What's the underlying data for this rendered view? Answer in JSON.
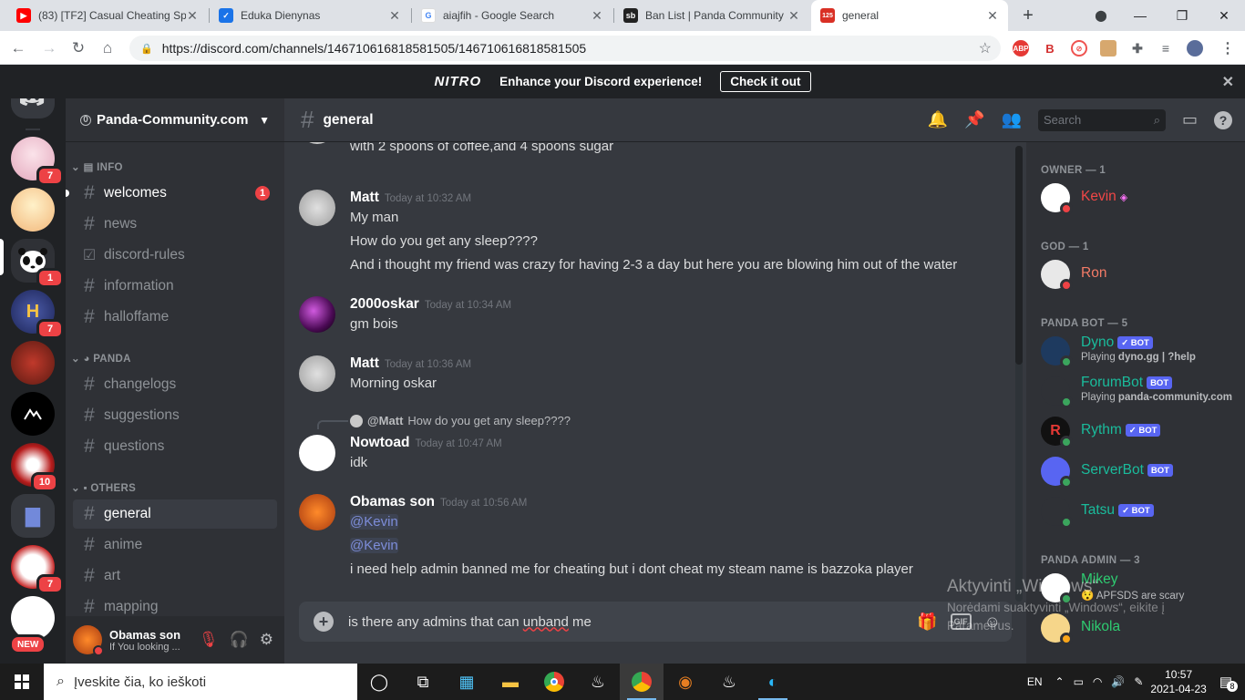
{
  "browser": {
    "tabs": [
      {
        "label": "(83) [TF2] Casual Cheating Sp",
        "icon": "youtube-icon",
        "color": "#ff0000"
      },
      {
        "label": "Eduka Dienynas",
        "icon": "eduka-icon",
        "color": "#1a73e8"
      },
      {
        "label": "aiajfih - Google Search",
        "icon": "google-icon",
        "color": "#4285f4"
      },
      {
        "label": "Ban List | Panda Community S",
        "icon": "sourcebans-icon",
        "color": "#222222"
      },
      {
        "label": "general",
        "icon": "calendar-icon",
        "color": "#d93025",
        "fav_text": "125"
      }
    ],
    "new_tab": "+",
    "url": "https://discord.com/channels/146710616818581505/146710616818581505"
  },
  "nitro": {
    "logo": "NITRO",
    "text": "Enhance your Discord experience!",
    "cta": "Check it out",
    "close": "✕"
  },
  "servers": [
    {
      "name": "anime-girl-server",
      "badge": "7",
      "color": "#e8b4c8"
    },
    {
      "name": "blonde-anime-server",
      "badge": "",
      "color": "#f6c98a"
    },
    {
      "name": "panda-community",
      "badge": "1",
      "color": "#2f3136"
    },
    {
      "name": "hypixel-server",
      "badge": "7",
      "color": "#3b4a8a"
    },
    {
      "name": "tf2-server",
      "badge": "",
      "color": "#8a3a2a"
    },
    {
      "name": "mountain-logo-server",
      "badge": "",
      "color": "#000000"
    },
    {
      "name": "red-character-server",
      "badge": "10",
      "color": "#8a1010"
    },
    {
      "name": "folder",
      "badge": "",
      "color": "#2f3136"
    },
    {
      "name": "cfab-server",
      "badge": "7",
      "color": "#dddddd"
    },
    {
      "name": "sketch-server",
      "badge": "",
      "color": "#ffffff"
    }
  ],
  "new_label": "NEW",
  "guild": {
    "name": "Panda-Community.com",
    "icon_text": "0"
  },
  "categories": [
    {
      "name": "INFO",
      "channels": [
        {
          "name": "welcomes",
          "badge": "1",
          "unread": true
        },
        {
          "name": "news"
        },
        {
          "name": "discord-rules",
          "rules": true
        },
        {
          "name": "information"
        },
        {
          "name": "halloffame"
        }
      ]
    },
    {
      "name": "PANDA",
      "channels": [
        {
          "name": "changelogs"
        },
        {
          "name": "suggestions"
        },
        {
          "name": "questions"
        }
      ]
    },
    {
      "name": "OTHERS",
      "channels": [
        {
          "name": "general",
          "selected": true
        },
        {
          "name": "anime"
        },
        {
          "name": "art"
        },
        {
          "name": "mapping"
        }
      ]
    }
  ],
  "user": {
    "name": "Obamas son",
    "status": "If You looking ..."
  },
  "channel": {
    "name": "general",
    "search_placeholder": "Search"
  },
  "messages": [
    {
      "author": "",
      "time": "",
      "lines": [
        "with 2 spoons of coffee,and 4 spoons sugar"
      ]
    },
    {
      "author": "Matt",
      "time": "Today at 10:32 AM",
      "lines": [
        "My man",
        "How do you get any sleep????",
        "And i thought my friend was crazy for having 2-3 a day but here you are blowing him out of the water"
      ]
    },
    {
      "author": "2000oskar",
      "time": "Today at 10:34 AM",
      "lines": [
        "gm bois"
      ]
    },
    {
      "author": "Matt",
      "time": "Today at 10:36 AM",
      "lines": [
        "Morning oskar"
      ]
    },
    {
      "author": "Nowtoad",
      "time": "Today at 10:47 AM",
      "lines": [
        "idk"
      ],
      "reply": {
        "author": "@Matt",
        "text": "How do you get any sleep????"
      }
    },
    {
      "author": "Obamas son",
      "time": "Today at 10:56 AM",
      "lines": [
        "@Kevin",
        "@Kevin",
        "i need help admin banned me for cheating but i dont cheat my steam name is bazzoka player"
      ]
    }
  ],
  "composer": {
    "text_before": "is there any admins that can ",
    "text_misspelled": "unband",
    "text_after": " me"
  },
  "watermark": {
    "title": "Aktyvinti „Windows“",
    "body": "Norėdami suaktyvinti „Windows“, eikite į Parametrus."
  },
  "members": {
    "groups": [
      {
        "title": "OWNER — 1",
        "members": [
          {
            "name": "Kevin",
            "color": "#f04747",
            "status": "dnd"
          }
        ]
      },
      {
        "title": "GOD — 1",
        "members": [
          {
            "name": "Ron",
            "color": "#f47b67",
            "status": "dnd"
          }
        ]
      },
      {
        "title": "PANDA BOT — 5",
        "members": [
          {
            "name": "Dyno",
            "color": "#1abc9c",
            "bot": "✓ BOT",
            "activity_pre": "Playing",
            "activity": "dyno.gg | ?help",
            "status": "online"
          },
          {
            "name": "ForumBot",
            "color": "#1abc9c",
            "bot": "BOT",
            "activity_pre": "Playing",
            "activity": "panda-community.com",
            "status": "online"
          },
          {
            "name": "Rythm",
            "color": "#1abc9c",
            "bot": "✓ BOT",
            "status": "online"
          },
          {
            "name": "ServerBot",
            "color": "#1abc9c",
            "bot": "BOT",
            "status": "online"
          },
          {
            "name": "Tatsu",
            "color": "#1abc9c",
            "bot": "✓ BOT",
            "status": "online"
          }
        ]
      },
      {
        "title": "PANDA ADMIN — 3",
        "members": [
          {
            "name": "Mikey",
            "color": "#2ecc71",
            "activity": "APFSDS are scary",
            "status": "online"
          },
          {
            "name": "Nikola",
            "color": "#2ecc71",
            "status": "idle"
          }
        ]
      }
    ]
  },
  "taskbar": {
    "search_placeholder": "Įveskite čia, ko ieškoti",
    "lang": "EN",
    "time": "10:57",
    "date": "2021-04-23",
    "notifications": "8"
  },
  "colors": {
    "accent": "#5865f2",
    "mention": "#7d8dd9",
    "danger": "#ed4245"
  }
}
